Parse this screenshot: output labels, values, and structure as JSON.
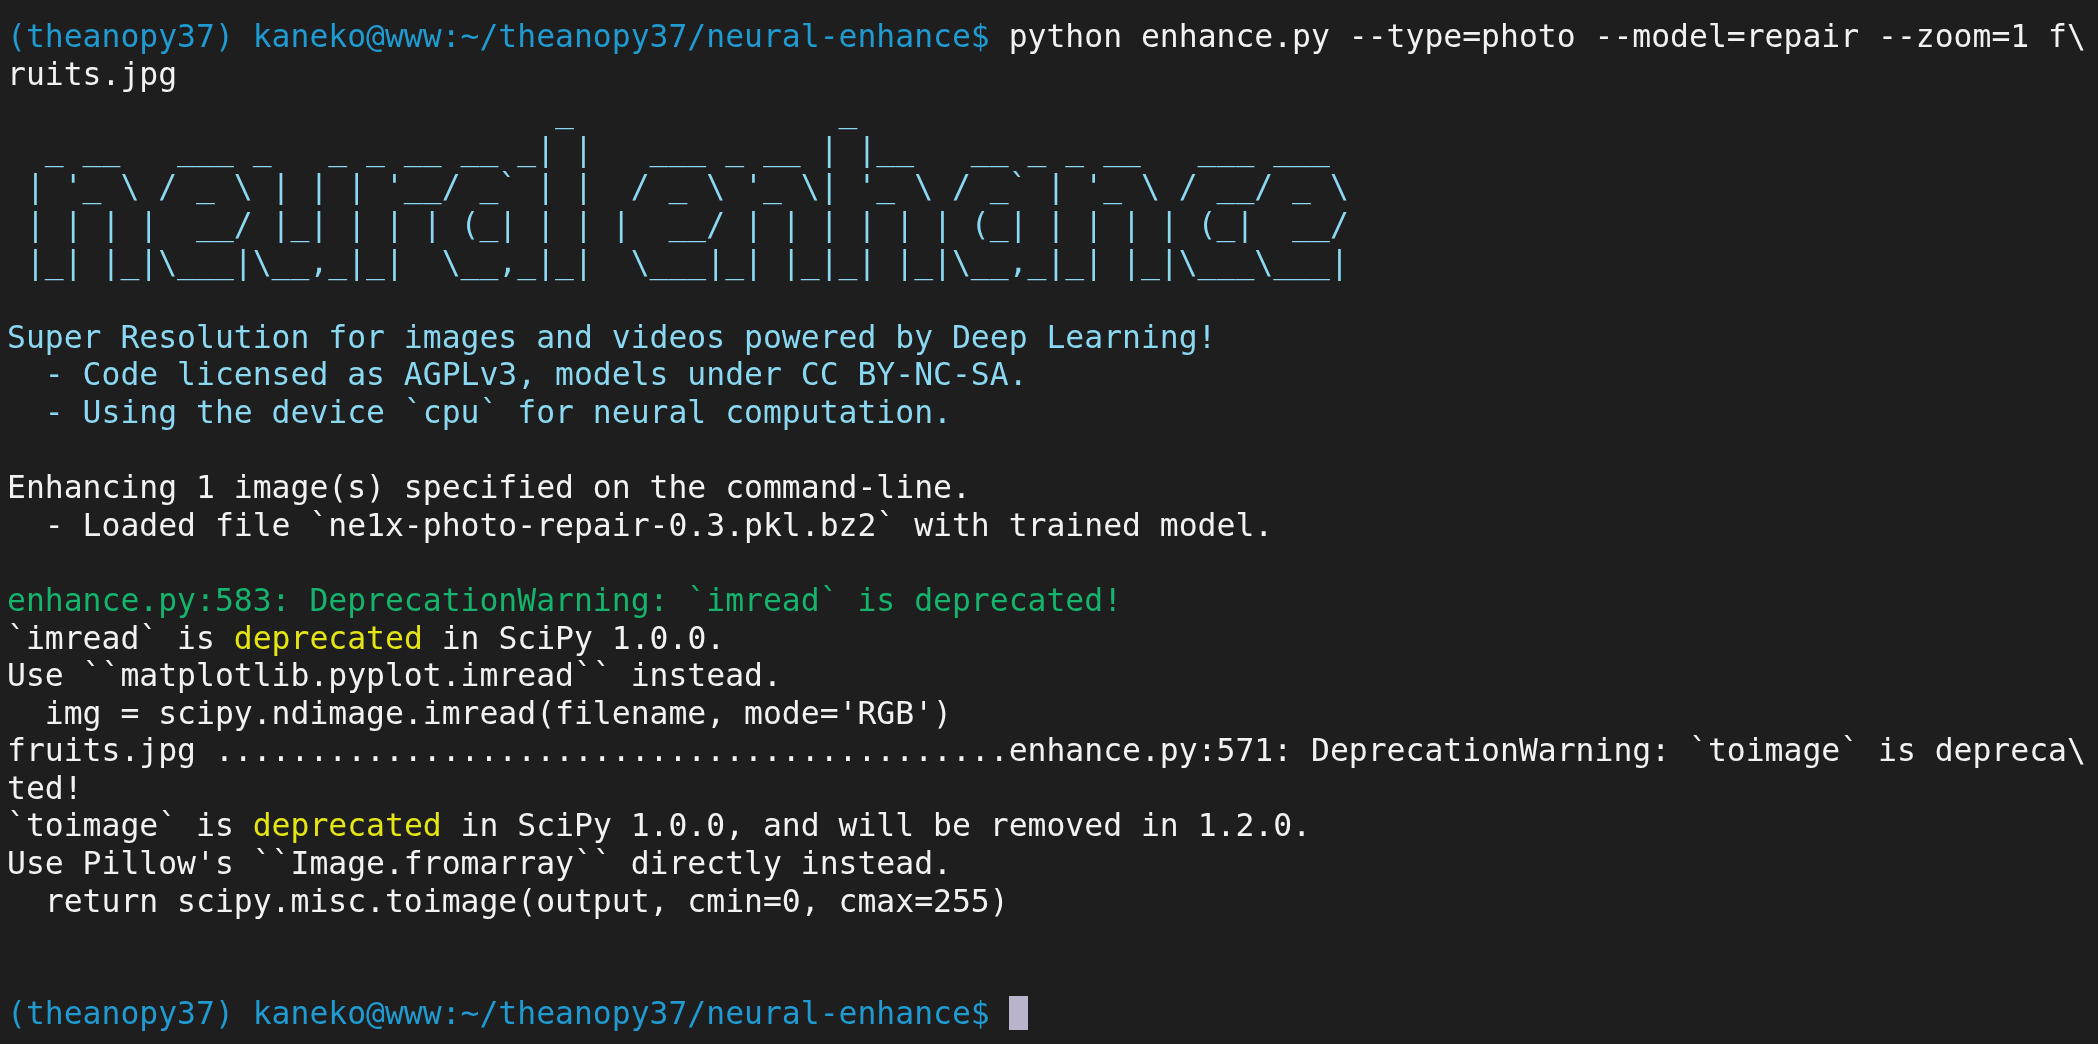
{
  "terminal": {
    "lines": [
      {
        "kind": "prompt",
        "prompt": "(theanopy37) kaneko@www:~/theanopy37/neural-enhance$",
        "command": "python enhance.py --type=photo --model=repair --zoom=1 f\\"
      },
      {
        "kind": "text",
        "segments": [
          {
            "text": "ruits.jpg",
            "kind": "plain"
          }
        ]
      },
      {
        "kind": "banner",
        "art": "                             _              _\n  _ __   ___ _   _ _ __ __ _| |   ___ _ __ | |__   __ _ _ __   ___ ___\n | '_ \\ / _ \\ | | | '__/ _` | |  / _ \\ '_ \\| '_ \\ / _` | '_ \\ / __/ _ \\\n | | | |  __/ |_| | | | (_| | | |  __/ | | | | | | (_| | | | | (_|  __/\n |_| |_|\\___|\\__,_|_|  \\__,_|_|  \\___|_| |_|_| |_|\\__,_|_| |_|\\___\\___|"
      },
      {
        "kind": "blank"
      },
      {
        "kind": "text",
        "segments": [
          {
            "text": "Super Resolution for images and videos powered by Deep Learning!",
            "kind": "info"
          }
        ]
      },
      {
        "kind": "text",
        "segments": [
          {
            "text": "  - Code licensed as AGPLv3, models under CC BY-NC-SA.",
            "kind": "info"
          }
        ]
      },
      {
        "kind": "text",
        "segments": [
          {
            "text": "  - Using the device `cpu` for neural computation.",
            "kind": "info"
          }
        ]
      },
      {
        "kind": "blank"
      },
      {
        "kind": "text",
        "segments": [
          {
            "text": "Enhancing 1 image(s) specified on the command-line.",
            "kind": "plain"
          }
        ]
      },
      {
        "kind": "text",
        "segments": [
          {
            "text": "  - Loaded file `ne1x-photo-repair-0.3.pkl.bz2` with trained model.",
            "kind": "plain"
          }
        ]
      },
      {
        "kind": "blank"
      },
      {
        "kind": "text",
        "segments": [
          {
            "text": "enhance.py:583: DeprecationWarning: `imread` is deprecated!",
            "kind": "warning"
          }
        ]
      },
      {
        "kind": "text",
        "segments": [
          {
            "text": "`imread` is ",
            "kind": "plain"
          },
          {
            "text": "deprecated",
            "kind": "highlight"
          },
          {
            "text": " in SciPy 1.0.0.",
            "kind": "plain"
          }
        ]
      },
      {
        "kind": "text",
        "segments": [
          {
            "text": "Use ``matplotlib.pyplot.imread`` instead.",
            "kind": "plain"
          }
        ]
      },
      {
        "kind": "text",
        "segments": [
          {
            "text": "  img = scipy.ndimage.imread(filename, mode='RGB')",
            "kind": "plain"
          }
        ]
      },
      {
        "kind": "text",
        "segments": [
          {
            "text": "fruits.jpg ..........................................enhance.py:571: DeprecationWarning: `toimage` is depreca\\",
            "kind": "plain"
          }
        ]
      },
      {
        "kind": "text",
        "segments": [
          {
            "text": "ted!",
            "kind": "plain"
          }
        ]
      },
      {
        "kind": "text",
        "segments": [
          {
            "text": "`toimage` is ",
            "kind": "plain"
          },
          {
            "text": "deprecated",
            "kind": "highlight"
          },
          {
            "text": " in SciPy 1.0.0, and will be removed in 1.2.0.",
            "kind": "plain"
          }
        ]
      },
      {
        "kind": "text",
        "segments": [
          {
            "text": "Use Pillow's ``Image.fromarray`` directly instead.",
            "kind": "plain"
          }
        ]
      },
      {
        "kind": "text",
        "segments": [
          {
            "text": "  return scipy.misc.toimage(output, cmin=0, cmax=255)",
            "kind": "plain"
          }
        ]
      },
      {
        "kind": "blank"
      },
      {
        "kind": "blank"
      },
      {
        "kind": "prompt",
        "prompt": "(theanopy37) kaneko@www:~/theanopy37/neural-enhance$",
        "cursor": true
      }
    ]
  }
}
